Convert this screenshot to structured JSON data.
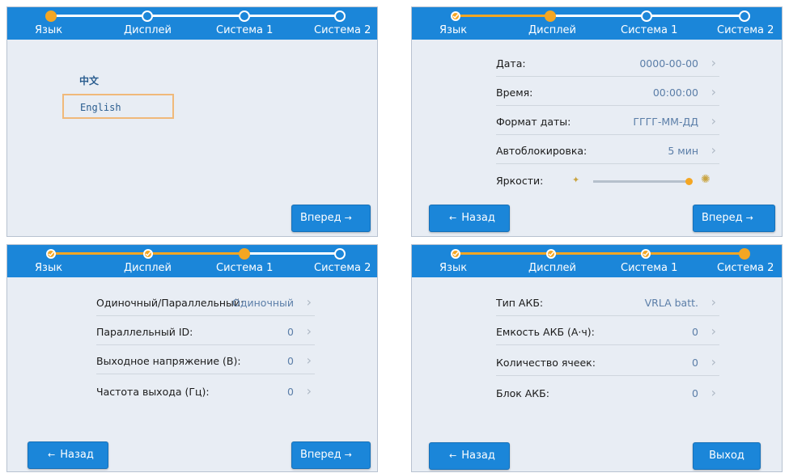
{
  "steps": [
    "Язык",
    "Дисплей",
    "Система 1",
    "Система 2"
  ],
  "panel1": {
    "languages": [
      "中文",
      "English"
    ],
    "selected": "English",
    "next_label": "Вперед"
  },
  "panel2": {
    "rows": [
      {
        "label": "Дата:",
        "value": "0000-00-00"
      },
      {
        "label": "Время:",
        "value": "00:00:00"
      },
      {
        "label": "Формат даты:",
        "value": "ГГГГ-ММ-ДД"
      },
      {
        "label": "Автоблокировка:",
        "value": "5 мин"
      }
    ],
    "brightness_label": "Яркости:",
    "brightness_level": 1.0,
    "back_label": "Назад",
    "next_label": "Вперед"
  },
  "panel3": {
    "rows": [
      {
        "label": "Одиночный/Параллельный:",
        "value": "Одиночный"
      },
      {
        "label": "Параллельный ID:",
        "value": "0"
      },
      {
        "label": "Выходное напряжение (В):",
        "value": "0"
      },
      {
        "label": "Частота выхода (Гц):",
        "value": "0"
      }
    ],
    "back_label": "Назад",
    "next_label": "Вперед"
  },
  "panel4": {
    "rows": [
      {
        "label": "Тип АКБ:",
        "value": "VRLA batt."
      },
      {
        "label": "Емкость АКБ (А·ч):",
        "value": "0"
      },
      {
        "label": "Количество ячеек:",
        "value": "0"
      },
      {
        "label": "Блок АКБ:",
        "value": "0"
      }
    ],
    "back_label": "Назад",
    "exit_label": "Выход"
  },
  "colors": {
    "header": "#1b86d9",
    "accent": "#f4a623",
    "panel_bg": "#e8edf4",
    "value_text": "#5b7ea8"
  },
  "icons": {
    "done_step": "checkmark-icon",
    "row_arrow": "chevron-right-icon",
    "brightness": "sun-icon"
  }
}
